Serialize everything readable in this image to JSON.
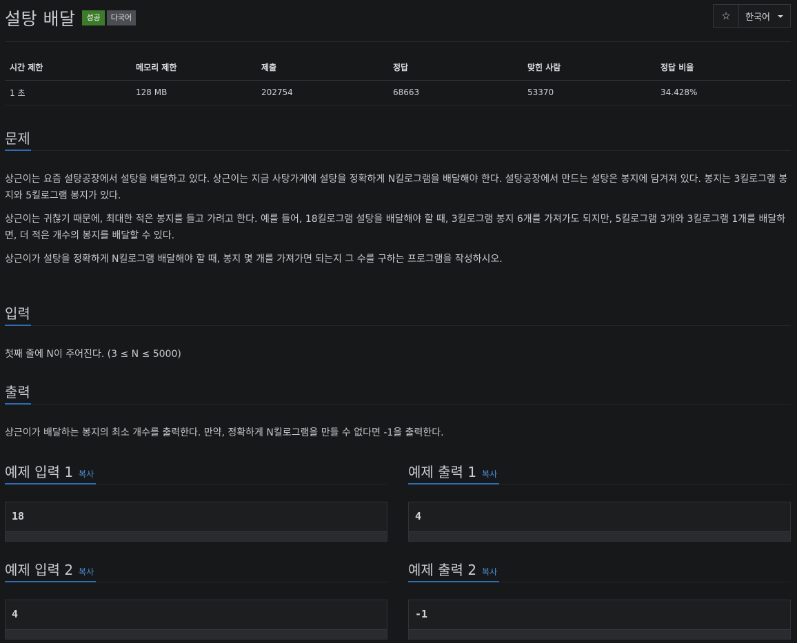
{
  "header": {
    "title": "설탕 배달",
    "badges": {
      "success": "성공",
      "multilang": "다국어"
    },
    "star_icon": "☆",
    "language": "한국어"
  },
  "info_table": {
    "headers": [
      "시간 제한",
      "메모리 제한",
      "제출",
      "정답",
      "맞힌 사람",
      "정답 비율"
    ],
    "values": [
      "1 초",
      "128 MB",
      "202754",
      "68663",
      "53370",
      "34.428%"
    ]
  },
  "problem": {
    "heading": "문제",
    "paragraphs": [
      "상근이는 요즘 설탕공장에서 설탕을 배달하고 있다. 상근이는 지금 사탕가게에 설탕을 정확하게 N킬로그램을 배달해야 한다. 설탕공장에서 만드는 설탕은 봉지에 담겨져 있다. 봉지는 3킬로그램 봉지와 5킬로그램 봉지가 있다.",
      "상근이는 귀찮기 때문에, 최대한 적은 봉지를 들고 가려고 한다. 예를 들어, 18킬로그램 설탕을 배달해야 할 때, 3킬로그램 봉지 6개를 가져가도 되지만, 5킬로그램 3개와 3킬로그램 1개를 배달하면, 더 적은 개수의 봉지를 배달할 수 있다.",
      "상근이가 설탕을 정확하게 N킬로그램 배달해야 할 때, 봉지 몇 개를 가져가면 되는지 그 수를 구하는 프로그램을 작성하시오."
    ]
  },
  "input": {
    "heading": "입력",
    "text": "첫째 줄에 N이 주어진다. (3 ≤ N ≤ 5000)"
  },
  "output": {
    "heading": "출력",
    "text": "상근이가 배달하는 봉지의 최소 개수를 출력한다. 만약, 정확하게 N킬로그램을 만들 수 없다면 -1을 출력한다."
  },
  "samples": {
    "copy_label": "복사",
    "input1": {
      "title": "예제 입력 1",
      "value": "18"
    },
    "output1": {
      "title": "예제 출력 1",
      "value": "4"
    },
    "input2": {
      "title": "예제 입력 2",
      "value": "4"
    },
    "output2": {
      "title": "예제 출력 2",
      "value": "-1"
    }
  }
}
